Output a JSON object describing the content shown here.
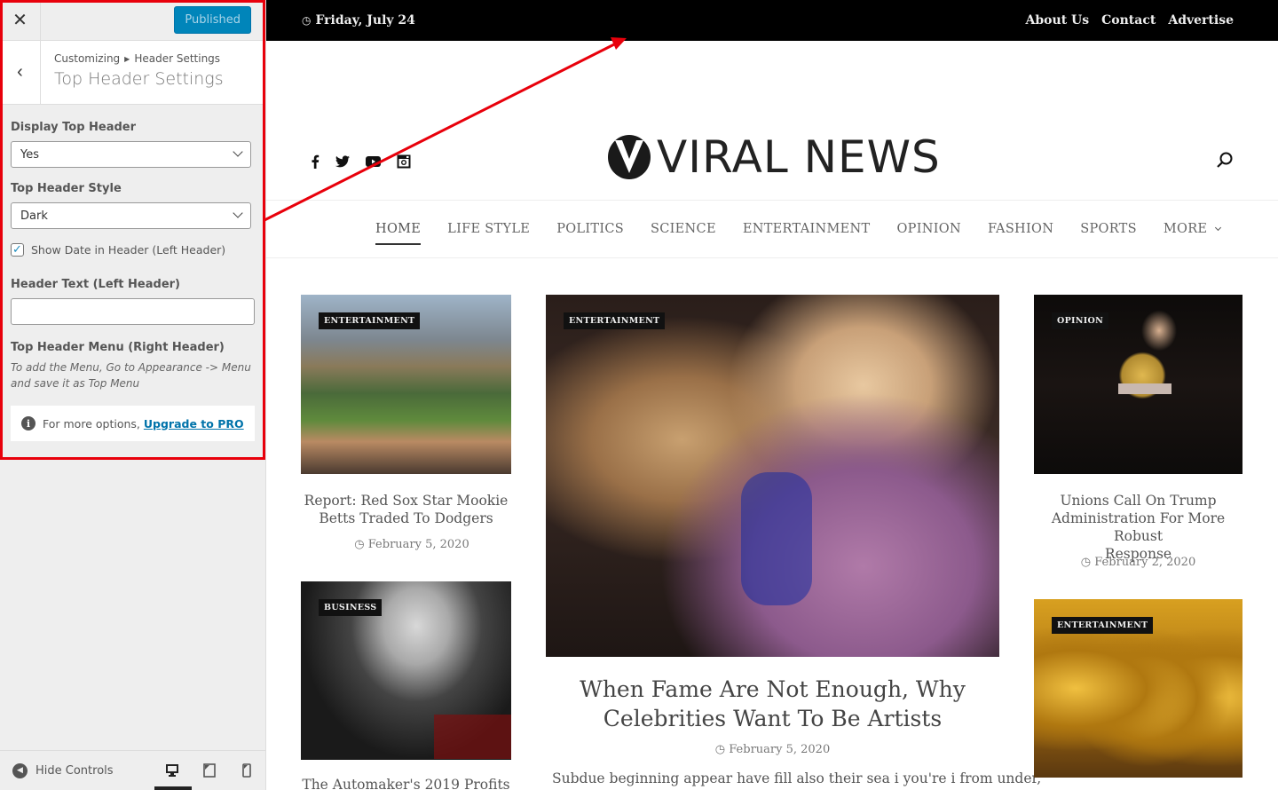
{
  "sidebar": {
    "close_icon": "close-icon",
    "publish_label": "Published",
    "breadcrumb_root": "Customizing",
    "breadcrumb_section": "Header Settings",
    "title": "Top Header Settings",
    "display_top_header": {
      "label": "Display Top Header",
      "value": "Yes"
    },
    "top_header_style": {
      "label": "Top Header Style",
      "value": "Dark"
    },
    "show_date": {
      "label": "Show Date in Header (Left Header)",
      "checked": true
    },
    "header_text": {
      "label": "Header Text (Left Header)",
      "value": ""
    },
    "top_header_menu": {
      "label": "Top Header Menu (Right Header)",
      "description_line1": "To add the Menu, Go to Appearance -> Menu",
      "description_line2": "and save it as Top Menu"
    },
    "pro_notice": {
      "text": "For more options,",
      "link": "Upgrade to PRO"
    },
    "footer": {
      "hide_controls": "Hide Controls",
      "active_device": "desktop"
    }
  },
  "colors": {
    "highlight": "#e8000b",
    "publish_bg": "#0085ba",
    "link": "#0073aa",
    "topbar_bg": "#000000"
  },
  "site": {
    "topbar": {
      "date": "Friday, July 24",
      "menu": [
        "About Us",
        "Contact",
        "Advertise"
      ]
    },
    "social": [
      "facebook-icon",
      "twitter-icon",
      "youtube-icon",
      "instagram-icon"
    ],
    "logo_text": "VIRAL NEWS",
    "nav": [
      "HOME",
      "LIFE STYLE",
      "POLITICS",
      "SCIENCE",
      "ENTERTAINMENT",
      "OPINION",
      "FASHION",
      "SPORTS",
      "MORE"
    ],
    "nav_active": "HOME",
    "posts": {
      "left1": {
        "tag": "ENTERTAINMENT",
        "title_l1": "Report: Red Sox Star Mookie",
        "title_l2": "Betts Traded To Dodgers",
        "date": "February 5, 2020"
      },
      "left2": {
        "tag": "BUSINESS",
        "title": "The Automaker's 2019 Profits"
      },
      "featured": {
        "tag": "ENTERTAINMENT",
        "title_l1": "When Fame Are Not Enough, Why",
        "title_l2": "Celebrities Want To Be Artists",
        "date": "February 5, 2020",
        "excerpt": "Subdue beginning appear have fill also their sea i you're i from under,"
      },
      "right1": {
        "tag": "OPINION",
        "title_l1": "Unions Call On Trump",
        "title_l2": "Administration For More Robust",
        "title_l3": "Response",
        "date": "February 2, 2020"
      },
      "right2": {
        "tag": "ENTERTAINMENT"
      }
    }
  }
}
